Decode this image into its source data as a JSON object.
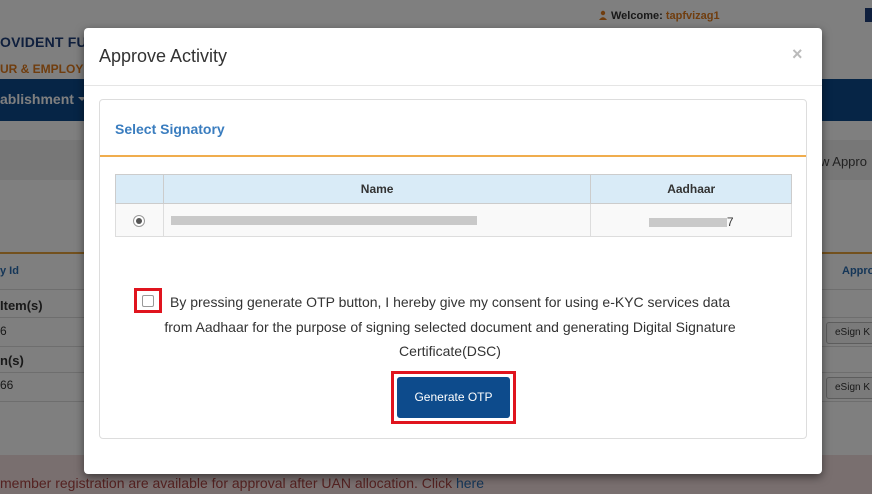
{
  "background": {
    "org_line1": "OVIDENT FUN",
    "org_line2": "UR & EMPLOYM",
    "welcome_label": "Welcome:",
    "welcome_user": "tapfvizag1",
    "nav_item": "ablishment",
    "view_approved": "w Appro",
    "col_id": "y Id",
    "col_appro": "Appro",
    "items_label_1": "Item(s)",
    "items_count_1": "6",
    "items_label_2": "n(s)",
    "items_count_2": "66",
    "esign_label": "eSign K",
    "alert_text": "member registration are available for approval after UAN allocation. Click ",
    "alert_link": "here"
  },
  "modal": {
    "title": "Approve Activity",
    "close_symbol": "×",
    "panel_title": "Select Signatory",
    "table": {
      "headers": [
        "",
        "Name",
        "Aadhaar"
      ],
      "rows": [
        {
          "selected": true,
          "aadhaar_prefix": "",
          "aadhaar_suffix": "7"
        }
      ]
    },
    "consent_text": "By pressing generate OTP button, I hereby give my consent for using e-KYC services data from Aadhaar for the purpose of signing selected document and generating Digital Signature Certificate(DSC)",
    "otp_button_label": "Generate OTP"
  },
  "colors": {
    "nav_blue": "#0d4b8c",
    "accent_orange": "#f0ad4e",
    "highlight_red": "#e0141e",
    "panel_title_blue": "#3a7dbf"
  },
  "icons": [
    "user-icon",
    "caret-down-icon",
    "close-icon",
    "radio-selected-icon",
    "checkbox-icon"
  ]
}
